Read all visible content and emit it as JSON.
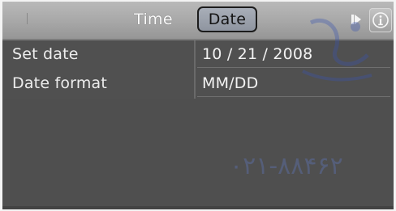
{
  "tabs": {
    "time_label": "Time",
    "date_label": "Date",
    "active": "Date"
  },
  "settings": [
    {
      "label": "Set date",
      "value": "10 / 21 / 2008"
    },
    {
      "label": "Date format",
      "value": "MM/DD"
    }
  ],
  "icons": {
    "scroll_right": "arrow-right-icon",
    "info": "info-icon"
  },
  "colors": {
    "screen_bg": "#505050",
    "tabbar_bg": "#a7a7a7",
    "active_tab_bg": "#979da8",
    "text": "#ededed"
  },
  "watermark": {
    "text": "۰۲۱-۸۸۴۶۲"
  }
}
